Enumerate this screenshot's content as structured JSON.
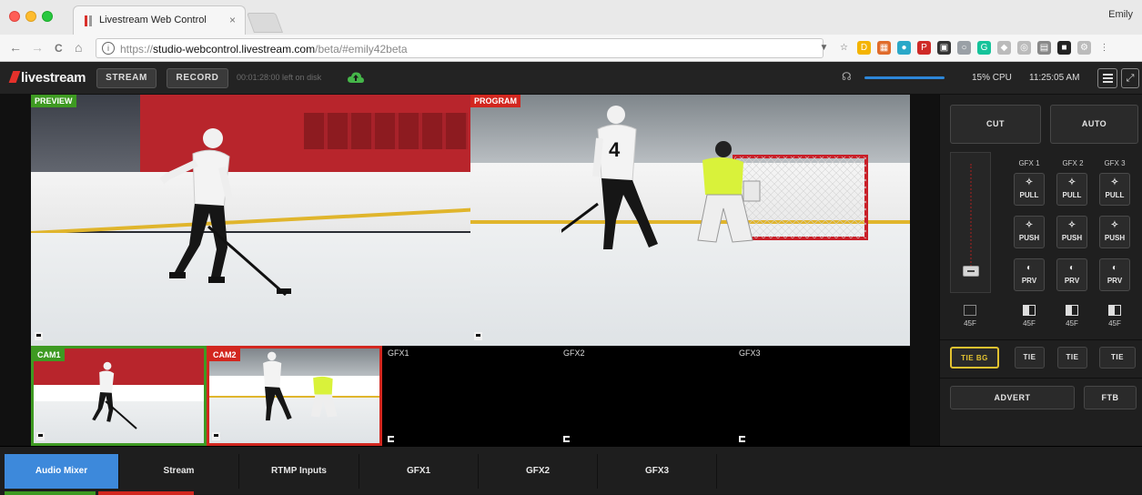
{
  "browser": {
    "tab_title": "Livestream Web Control",
    "tab_close": "×",
    "profile_name": "Emily",
    "url_scheme": "https://",
    "url_host": "studio-webcontrol.livestream.com",
    "url_path": "/beta/#emily42beta",
    "nav_back": "←",
    "nav_forward": "→",
    "nav_reload": "C",
    "nav_home": "⌂",
    "info_glyph": "i",
    "extensions": [
      {
        "name": "filter",
        "color": "#666666",
        "glyph": "▼"
      },
      {
        "name": "star",
        "color": "#666666",
        "glyph": "☆"
      },
      {
        "name": "docs",
        "color": "#f4b400",
        "glyph": "D"
      },
      {
        "name": "calendar",
        "color": "#e06b2b",
        "glyph": "▦"
      },
      {
        "name": "chat",
        "color": "#2aa8c8",
        "glyph": "●"
      },
      {
        "name": "pinterest",
        "color": "#cf2a27",
        "glyph": "P"
      },
      {
        "name": "save",
        "color": "#333333",
        "glyph": "▣"
      },
      {
        "name": "clock",
        "color": "#9aa0a6",
        "glyph": "○"
      },
      {
        "name": "grammarly",
        "color": "#15c39a",
        "glyph": "G"
      },
      {
        "name": "drop",
        "color": "#bbbbbb",
        "glyph": "◆"
      },
      {
        "name": "loop",
        "color": "#bbbbbb",
        "glyph": "◎"
      },
      {
        "name": "window",
        "color": "#888888",
        "glyph": "▤"
      },
      {
        "name": "book",
        "color": "#222222",
        "glyph": "■"
      },
      {
        "name": "settings",
        "color": "#bbbbbb",
        "glyph": "⚙"
      },
      {
        "name": "more",
        "color": "#666666",
        "glyph": "⋮"
      }
    ]
  },
  "appbar": {
    "logo": "livestream",
    "stream_label": "STREAM",
    "record_label": "RECORD",
    "disk_info": "00:01:28:00 left on disk",
    "headphones_glyph": "☊",
    "cpu": "15% CPU",
    "clock": "11:25:05 AM",
    "expand_glyph": "⤢",
    "volume_level": 1.0
  },
  "monitors": {
    "preview_label": "PREVIEW",
    "program_label": "PROGRAM"
  },
  "sources": [
    {
      "label": "CAM1",
      "state": "preview"
    },
    {
      "label": "CAM2",
      "state": "program"
    },
    {
      "label": "GFX1",
      "state": "empty"
    },
    {
      "label": "GFX2",
      "state": "empty"
    },
    {
      "label": "GFX3",
      "state": "empty"
    }
  ],
  "controls": {
    "cut": "CUT",
    "auto": "AUTO",
    "gfx_columns": [
      "GFX 1",
      "GFX 2",
      "GFX 3"
    ],
    "pull": "PULL",
    "push": "PUSH",
    "prv": "PRV",
    "duration": "45F",
    "tie_bg": "TIE BG",
    "tie": "TIE",
    "advert": "ADVERT",
    "ftb": "FTB",
    "pull_glyph": "✧",
    "push_glyph": "✧",
    "prv_glyph": "◐"
  },
  "bottom_tabs": [
    "Audio Mixer",
    "Stream",
    "RTMP Inputs",
    "GFX1",
    "GFX2",
    "GFX3"
  ],
  "colors": {
    "accent": "#3d89db",
    "preview": "#3e9a22",
    "program": "#d2271f",
    "tie_bg": "#e3c230"
  }
}
